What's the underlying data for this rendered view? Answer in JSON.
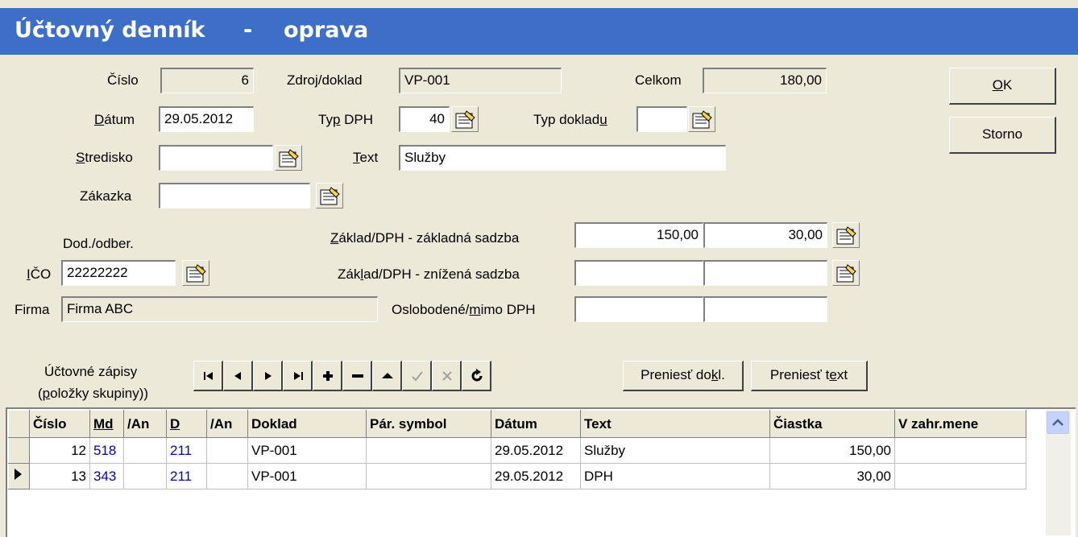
{
  "window": {
    "title_part1": "Účtovný denník",
    "title_sep": "-",
    "title_part2": "oprava"
  },
  "header": {
    "cislo_label": "Číslo",
    "cislo_value": "6",
    "zdroj_label": "Zdroj/doklad",
    "zdroj_value": "VP-001",
    "celkom_label": "Celkom",
    "celkom_value": "180,00",
    "datum_label_u": "D",
    "datum_label_rest": "átum",
    "datum_value": "29.05.2012",
    "typdph_label_a": "Ty",
    "typdph_label_u": "p",
    "typdph_label_b": " DPH",
    "typdph_value": "40",
    "typdokladu_label_a": "Typ doklad",
    "typdokladu_label_u": "u",
    "typdokladu_value": "",
    "stredisko_label_u": "S",
    "stredisko_label_rest": "tredisko",
    "stredisko_value": "",
    "text_label_u": "T",
    "text_label_rest": "ext",
    "text_value": "Služby",
    "zakazka_label": "Zákazka",
    "zakazka_value": "",
    "dododber_label": "Dod./odber.",
    "ico_label_u": "I",
    "ico_label_rest": "ČO",
    "ico_value": "22222222",
    "firma_label": "Firma",
    "firma_value": "Firma ABC"
  },
  "dph": {
    "zakladna_label_u": "Z",
    "zakladna_label_rest": "áklad/DPH - základná sadzba",
    "zakladna_zaklad": "150,00",
    "zakladna_dph": "30,00",
    "znizena_label_a": "Zák",
    "znizena_label_u": "l",
    "znizena_label_b": "ad/DPH - znížená sadzba",
    "znizena_zaklad": "",
    "znizena_dph": "",
    "oslobodene_label_a": "Oslobodené/",
    "oslobodene_label_u": "m",
    "oslobodene_label_b": "imo DPH",
    "oslobodene_a": "",
    "oslobodene_b": ""
  },
  "buttons": {
    "ok_u": "O",
    "ok_rest": "K",
    "storno": "Storno",
    "preniest_dokl_a": "Preniesť do",
    "preniest_dokl_u": "k",
    "preniest_dokl_b": "l.",
    "preniest_text_a": "Preniesť t",
    "preniest_text_u": "e",
    "preniest_text_b": "xt"
  },
  "zapisy": {
    "line1": "Účtovné zápisy",
    "line2_u": "p",
    "line2_rest": "oložky skupiny)",
    "line2_open": "("
  },
  "nav_icons": [
    "first-icon",
    "prev-icon",
    "next-icon",
    "last-icon",
    "plus-icon",
    "minus-icon",
    "up-icon",
    "check-icon",
    "cancel-icon",
    "refresh-icon"
  ],
  "table": {
    "columns": [
      "Číslo",
      "Md",
      "/An",
      "D",
      "/An",
      "Doklad",
      "Pár. symbol",
      "Dátum",
      "Text",
      "Čiastka",
      "V zahr.mene"
    ],
    "rows": [
      {
        "cislo": "12",
        "md": "518",
        "an1": "",
        "d": "211",
        "an2": "",
        "doklad": "VP-001",
        "par": "",
        "datum": "29.05.2012",
        "text": "Služby",
        "ciastka": "150,00",
        "zahr": ""
      },
      {
        "cislo": "13",
        "md": "343",
        "an1": "",
        "d": "211",
        "an2": "",
        "doklad": "VP-001",
        "par": "",
        "datum": "29.05.2012",
        "text": "DPH",
        "ciastka": "30,00",
        "zahr": ""
      }
    ]
  },
  "colors": {
    "title_bar": "#3e6fc8",
    "background": "#ece9d8",
    "account_link": "#0000c0"
  }
}
